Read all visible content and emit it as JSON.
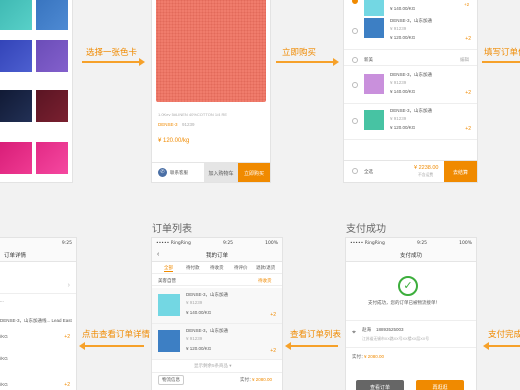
{
  "colors": {
    "accent": "#f08a00",
    "fabric_coral": "#f07c6c",
    "fabric_cyan": "#73d7e3",
    "fabric_blue": "#3d7fc4",
    "fabric_violet": "#c990dc",
    "fabric_teal": "#47c3a3"
  },
  "flow": {
    "choose_swatch": "选择一张色卡",
    "buy_now": "立即购买",
    "fill_order": "填写订单信",
    "view_order_detail": "点击查看订单详情",
    "view_order_list": "查看订单列表",
    "pay_done": "支付完成"
  },
  "titles": {
    "order_list": "订单列表",
    "pay_success": "支付成功"
  },
  "product": {
    "desc": "1.0Kev 5#LINEN 40%COTTON 1/4 RE",
    "name": "DENSE-3",
    "code": "91239",
    "price": "¥ 120.00/kg",
    "contact": "联系客服",
    "add_cart": "加入购物车",
    "buy": "立即购买"
  },
  "cart": {
    "items": [
      {
        "name": "DENSE-3，山东加通",
        "code": "¥ 91239",
        "price1": "¥ 140.00/KG",
        "price2": "¥ 120.00/KG",
        "qty": "+2"
      },
      {
        "name": "DENSE-3，山东加通",
        "code": "¥ 91239",
        "price1": "¥ 140.00/KG",
        "price2": "¥ 120.00/KG",
        "qty": "+2"
      }
    ],
    "group_label": "新美",
    "group_action": "编辑",
    "select_all": "全选",
    "total": "¥ 2238.00",
    "total_sub": "不含运费",
    "checkout": "去结算"
  },
  "detail_phone": {
    "title": "订单详情",
    "line1": "...",
    "line2": "DENSE-3，山东加通线... Lead East",
    "line3": "/KG",
    "line4": "/KG",
    "line5": "/KG",
    "qty": "+2"
  },
  "orders_phone": {
    "carrier": "••••• RingRing",
    "time": "9:25",
    "battery": "100%",
    "back": "‹",
    "title": "我的订单",
    "tabs": [
      "全部",
      "待付款",
      "待收货",
      "待评价",
      "退款/退货"
    ],
    "shop": "美客自营",
    "shop_status": "待收货",
    "items": [
      {
        "name": "DENSE-3，山东加通",
        "code": "¥ 91239",
        "price": "¥ 140.00/KG",
        "qty": "+2"
      },
      {
        "name": "DENSE-3，山东加通",
        "code": "¥ 91239",
        "price": "¥ 120.00/KG",
        "qty": "+2"
      }
    ],
    "more": "显示剩余5条商品 ▾",
    "logistics": "物流信息",
    "paid_label": "实付：",
    "paid": "¥ 2080.00"
  },
  "paid_phone": {
    "carrier": "••••• RingRing",
    "time": "9:25",
    "battery": "100%",
    "title": "支付成功",
    "msg": "支付成功，您的订单已被物流接单！",
    "receiver": "赵海",
    "phone": "18893525003",
    "address": "江苏省无锡市XX路XX号XX楼XX层XX号",
    "paid_label": "实付：",
    "paid": "¥ 2080.00",
    "btn_left": "查看订单",
    "btn_right": "再逛逛"
  },
  "detail_status": {
    "time": "9:25"
  }
}
